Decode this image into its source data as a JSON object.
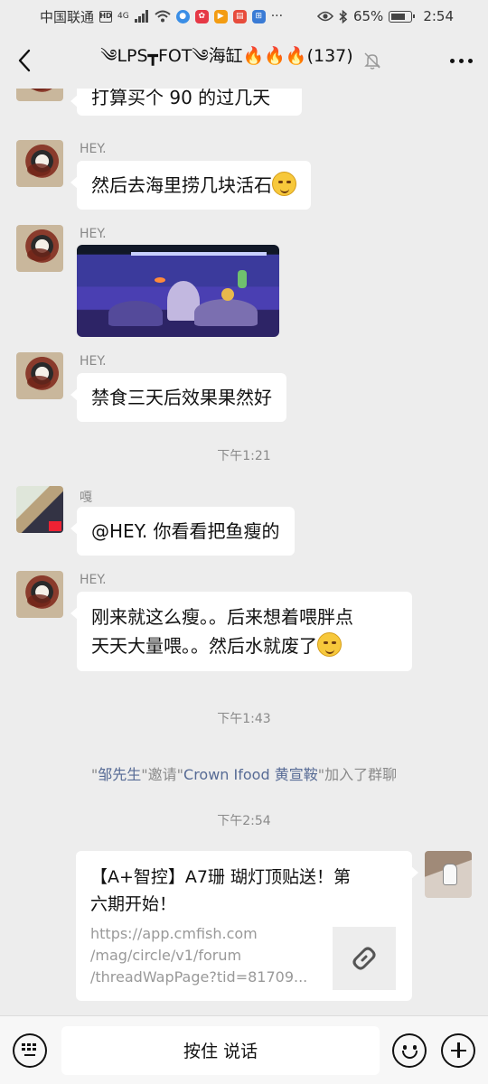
{
  "status": {
    "carrier": "中国联通",
    "network": "4G",
    "battery": "65%",
    "time": "2:54"
  },
  "header": {
    "title": "༄LPS┳FOT༄海缸🔥🔥🔥(137)"
  },
  "messages": [
    {
      "sender": "",
      "text": "打算买个 90 的过几天"
    },
    {
      "sender": "HEY.",
      "text": "然后去海里捞几块活石"
    },
    {
      "sender": "HEY.",
      "image": "aquarium-photo"
    },
    {
      "sender": "HEY.",
      "text": "禁食三天后效果果然好"
    },
    {
      "sender": "嘎",
      "text": "@HEY.  你看看把鱼瘦的"
    },
    {
      "sender": "HEY.",
      "line1": "刚来就这么瘦。。后来想着喂胖点",
      "line2": "天天大量喂。。然后水就废了"
    }
  ],
  "timestamps": [
    "下午1:21",
    "下午1:43",
    "下午2:54"
  ],
  "system_message": {
    "q1": "\"",
    "inviter": "邹先生",
    "mid1": "\"邀请\"",
    "invitee": "Crown Ifood 黄宣鞍",
    "tail": "\"加入了群聊"
  },
  "link_card": {
    "title_line1": "【A+智控】A7珊 瑚灯顶贴送！第",
    "title_line2": "六期开始！",
    "url_line1": "https://app.cmfish.com",
    "url_line2": "/mag/circle/v1/forum",
    "url_line3": "/threadWapPage?tid=81709..."
  },
  "input_bar": {
    "hold_to_talk": "按住 说话"
  },
  "icons": [
    "back-icon",
    "mute-icon",
    "more-icon",
    "keyboard-icon",
    "emoji-icon",
    "plus-icon",
    "link-icon"
  ]
}
